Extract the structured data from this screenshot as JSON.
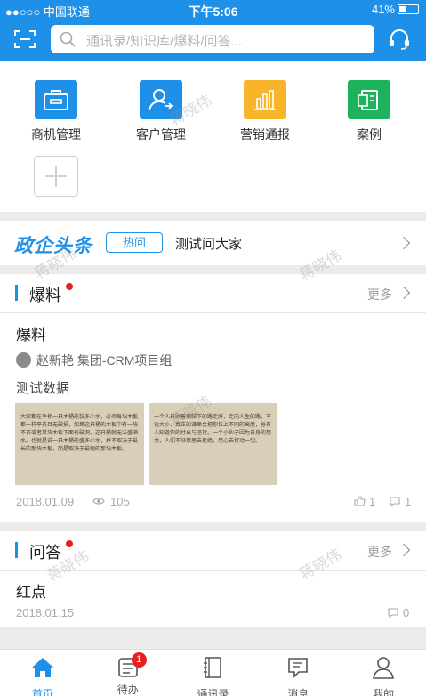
{
  "status_bar": {
    "carrier": "●●○○○ 中国联通",
    "time": "下午5:06",
    "battery": "41%"
  },
  "search": {
    "placeholder": "通讯录/知识库/爆料/问答..."
  },
  "quick_apps": [
    {
      "label": "商机管理",
      "color": "#1e90e8",
      "icon": "briefcase-icon"
    },
    {
      "label": "客户管理",
      "color": "#1e90e8",
      "icon": "customer-icon"
    },
    {
      "label": "营销通报",
      "color": "#f7b52c",
      "icon": "bar-chart-icon"
    },
    {
      "label": "案例",
      "color": "#1db25c",
      "icon": "document-icon"
    }
  ],
  "headline": {
    "logo": "政企头条",
    "tag": "热问",
    "text": "测试问大家"
  },
  "baoliao": {
    "title": "爆料",
    "more": "更多",
    "post": {
      "title": "爆料",
      "author": "赵新艳 集团-CRM项目组",
      "body": "测试数据",
      "images": [
        {
          "title": "",
          "text": "大家都在争相一只木桶能装多少水，必须每块木板都一样平齐且无破损，如果这只桶的木板中有一块不齐或者某块木板下面有破洞，这只桶就无法盛满水。也就是说一只木桶能盛多少水，并不取决于最长的那块木板，而是取决于最短的那块木板。"
        },
        {
          "title": "",
          "text": "一个人只顾着把脚下的路走好，走向人生的路，不论大小，真正的谦卑会把你拉上不同的高度，总有人知道你的付出与坚持。一个小伙子因为自身的努力，人们不好意思去拒绝，用心去打动一切。"
        }
      ],
      "date": "2018.01.09",
      "views": "105",
      "likes": "1",
      "comments": "1"
    }
  },
  "wenda": {
    "title": "问答",
    "more": "更多",
    "post": {
      "title": "红点",
      "date": "2018.01.15",
      "comments": "0"
    }
  },
  "tabs": [
    {
      "label": "首页",
      "active": true
    },
    {
      "label": "待办",
      "badge": "1"
    },
    {
      "label": "通讯录"
    },
    {
      "label": "消息"
    },
    {
      "label": "我的"
    }
  ],
  "watermark": "蒋晓伟",
  "colors": {
    "primary": "#1e90e8",
    "badge": "#e6201d"
  }
}
